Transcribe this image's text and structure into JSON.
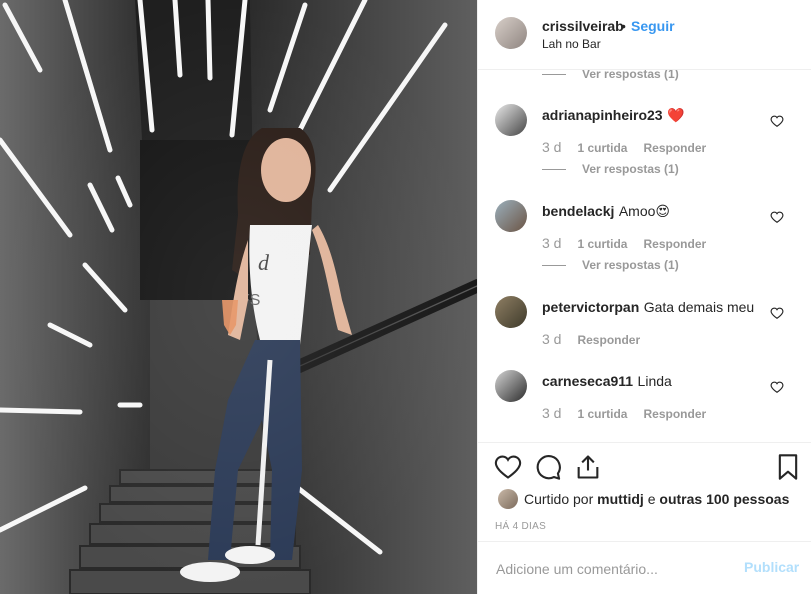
{
  "header": {
    "username": "crissilveirab",
    "separator": "•",
    "follow_label": "Seguir",
    "location": "Lah no Bar"
  },
  "comments": {
    "top_view_replies": "Ver respostas (1)",
    "items": [
      {
        "username": "adrianapinheiro23",
        "text": "❤️",
        "age": "3 d",
        "likes": "1 curtida",
        "reply": "Responder",
        "view_replies": "Ver respostas (1)"
      },
      {
        "username": "bendelackj",
        "text": "Amoo😍",
        "age": "3 d",
        "likes": "1 curtida",
        "reply": "Responder",
        "view_replies": "Ver respostas (1)"
      },
      {
        "username": "petervictorpan",
        "text": "Gata demais meu",
        "age": "3 d",
        "likes": "",
        "reply": "Responder",
        "view_replies": ""
      },
      {
        "username": "carneseca911",
        "text": "Linda",
        "age": "3 d",
        "likes": "1 curtida",
        "reply": "Responder",
        "view_replies": ""
      }
    ]
  },
  "actions": {
    "icons": [
      "heart-icon",
      "comment-icon",
      "share-icon",
      "bookmark-icon"
    ],
    "liked_prefix": "Curtido por",
    "liked_user": "muttidj",
    "liked_mid": "e",
    "liked_others": "outras 100 pessoas",
    "time": "HÁ 4 DIAS"
  },
  "add_comment": {
    "placeholder": "Adicione um comentário...",
    "publish_label": "Publicar"
  },
  "colors": {
    "link": "#3897f0",
    "publish_disabled": "#b2dffc",
    "muted": "#999999",
    "heart": "#ed4956"
  }
}
